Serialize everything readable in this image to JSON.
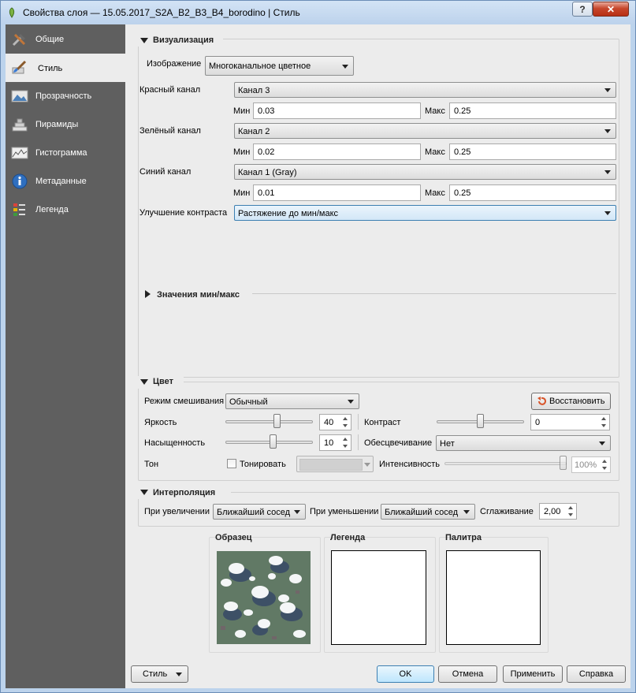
{
  "window": {
    "title": "Свойства слоя — 15.05.2017_S2A_B2_B3_B4_borodino | Стиль",
    "help_button": "?",
    "close_button": "✕"
  },
  "sidebar": {
    "items": [
      {
        "label": "Общие",
        "icon": "tools-icon"
      },
      {
        "label": "Стиль",
        "icon": "paintbrush-icon"
      },
      {
        "label": "Прозрачность",
        "icon": "transparency-icon"
      },
      {
        "label": "Пирамиды",
        "icon": "pyramid-icon"
      },
      {
        "label": "Гистограмма",
        "icon": "histogram-icon"
      },
      {
        "label": "Метаданные",
        "icon": "info-icon"
      },
      {
        "label": "Легенда",
        "icon": "legend-icon"
      }
    ],
    "active": "Стиль"
  },
  "render": {
    "section_title": "Визуализация",
    "image_label": "Изображение",
    "image_type": "Многоканальное цветное",
    "min_label": "Мин",
    "max_label": "Макс",
    "red": {
      "label": "Красный канал",
      "band": "Канал 3",
      "min": "0.03",
      "max": "0.25"
    },
    "green": {
      "label": "Зелёный канал",
      "band": "Канал 2",
      "min": "0.02",
      "max": "0.25"
    },
    "blue": {
      "label": "Синий канал",
      "band": "Канал 1 (Gray)",
      "min": "0.01",
      "max": "0.25"
    },
    "contrast_label": "Улучшение контраста",
    "contrast_value": "Растяжение до мин/макс",
    "minmax_title": "Значения мин/макс"
  },
  "color": {
    "section_title": "Цвет",
    "blend_label": "Режим смешивания",
    "blend_value": "Обычный",
    "reset_button": "Восстановить",
    "brightness_label": "Яркость",
    "brightness_value": "40",
    "brightness_level": 0.6,
    "contrast_label": "Контраст",
    "contrast_value": "0",
    "contrast_level": 0.5,
    "saturation_label": "Насыщенность",
    "saturation_value": "10",
    "saturation_level": 0.55,
    "grayscale_label": "Обесцвечивание",
    "grayscale_value": "Нет",
    "hue_label": "Тон",
    "colorize_label": "Тонировать",
    "intensity_label": "Интенсивность",
    "intensity_value": "100%",
    "intensity_level": 1.0
  },
  "resampling": {
    "section_title": "Интерполяция",
    "zoomed_in_label": "При увеличении",
    "zoomed_in_value": "Ближайший сосед",
    "zoomed_out_label": "При уменьшении",
    "zoomed_out_value": "Ближайший сосед",
    "oversampling_label": "Сглаживание",
    "oversampling_value": "2,00"
  },
  "previews": {
    "sample_title": "Образец",
    "legend_title": "Легенда",
    "palette_title": "Палитра"
  },
  "footer": {
    "style_button": "Стиль",
    "ok_button": "OK",
    "cancel_button": "Отмена",
    "apply_button": "Применить",
    "help_button": "Справка"
  }
}
